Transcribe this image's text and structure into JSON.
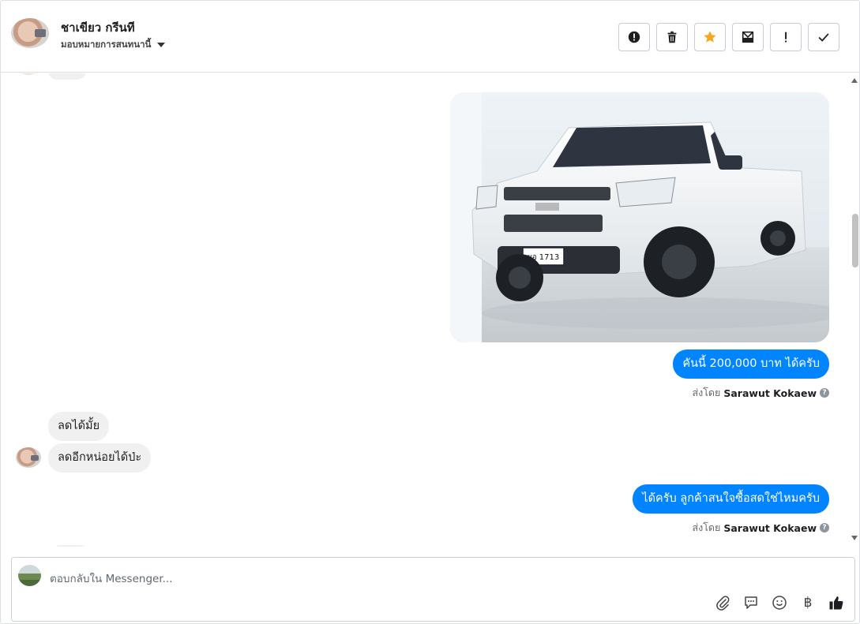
{
  "header": {
    "contact_name": "ชาเขียว กรีนที",
    "assign_label": "มอบหมายการสนทนานี้",
    "actions": [
      {
        "name": "report-button",
        "icon": "alert-circle-icon"
      },
      {
        "name": "delete-button",
        "icon": "trash-icon"
      },
      {
        "name": "star-button",
        "icon": "star-icon",
        "color": "#f5a623"
      },
      {
        "name": "mark-unread-button",
        "icon": "envelope-icon"
      },
      {
        "name": "follow-up-button",
        "icon": "exclamation-icon"
      },
      {
        "name": "mark-done-button",
        "icon": "check-icon"
      }
    ]
  },
  "messages": [
    {
      "direction": "out",
      "type": "image",
      "alt_subject": "white pickup truck"
    },
    {
      "direction": "out",
      "text": "คันนี้ 200,000 บาท ได้ครับ",
      "sent_by_prefix": "ส่งโดย",
      "sent_by_name": "Sarawut Kokaew"
    },
    {
      "direction": "in",
      "text": "ลดได้มั้ย"
    },
    {
      "direction": "in",
      "text": "ลดอีกหน่อยได้ป่ะ"
    },
    {
      "direction": "out",
      "text": "ได้ครับ ลูกค้าสนใจซื้อสดใช่ไหมครับ",
      "sent_by_prefix": "ส่งโดย",
      "sent_by_name": "Sarawut Kokaew"
    }
  ],
  "composer": {
    "placeholder": "ตอบกลับใน Messenger...",
    "tools": [
      "paperclip-icon",
      "saved-reply-icon",
      "emoji-icon",
      "baht-icon",
      "thumbs-up-icon"
    ],
    "baht_glyph": "฿"
  },
  "colors": {
    "accent": "#0084ff",
    "incoming_bubble": "#f0f0f0",
    "star": "#f5a623"
  },
  "image": {
    "plate_text": "ผอ 1713"
  }
}
